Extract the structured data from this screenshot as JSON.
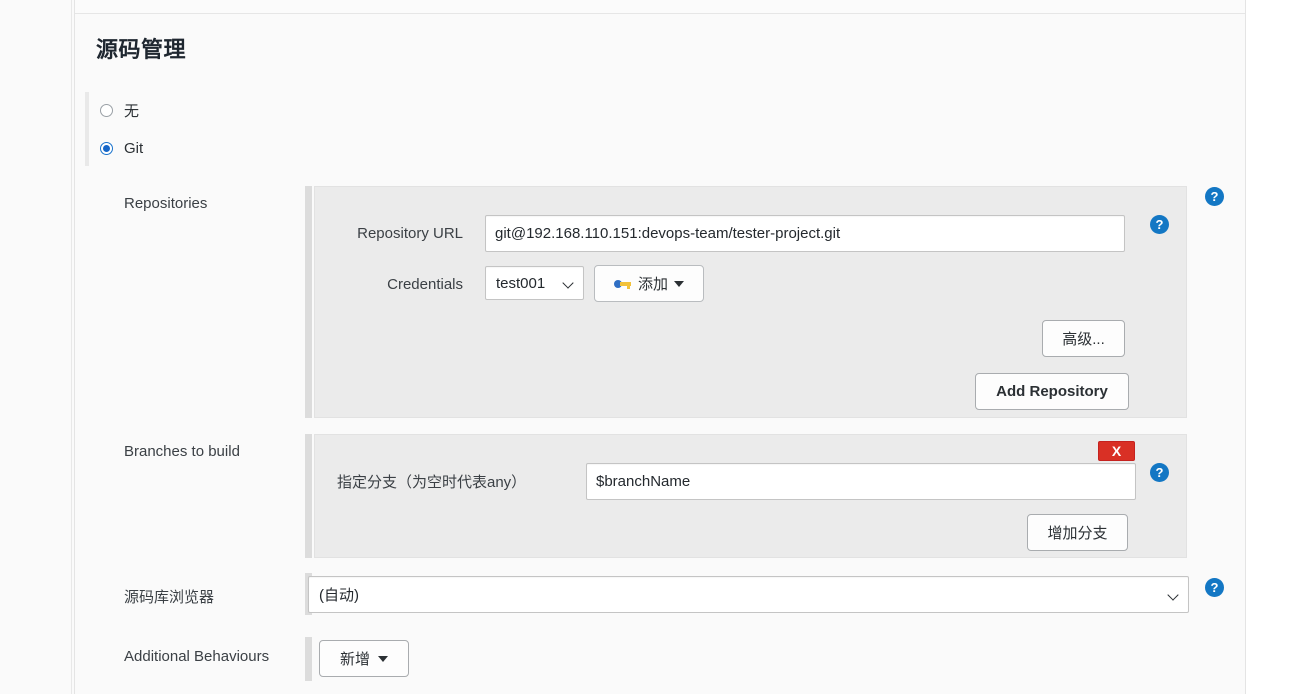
{
  "section": {
    "title": "源码管理"
  },
  "scm_choice": {
    "options": [
      {
        "label": "无",
        "checked": false
      },
      {
        "label": "Git",
        "checked": true
      }
    ]
  },
  "repositories": {
    "label": "Repositories",
    "repository_url": {
      "label": "Repository URL",
      "value": "git@192.168.110.151:devops-team/tester-project.git"
    },
    "credentials": {
      "label": "Credentials",
      "selected": "test001",
      "add_button": "添加"
    },
    "advanced_button": "高级...",
    "add_repository_button": "Add Repository"
  },
  "branches": {
    "label": "Branches to build",
    "branch_spec": {
      "label": "指定分支（为空时代表any）",
      "value": "$branchName"
    },
    "delete_button": "X",
    "add_branch_button": "增加分支"
  },
  "repo_browser": {
    "label": "源码库浏览器",
    "selected": "(自动)"
  },
  "additional_behaviours": {
    "label": "Additional Behaviours",
    "add_button": "新增"
  },
  "icons": {
    "help": "?"
  },
  "colors": {
    "accent_blue": "#1377c4",
    "radio_blue": "#1566c8",
    "delete_red": "#d93025",
    "panel_gray": "#ebebeb",
    "page_gray": "#fafafa",
    "key_gold": "#f2c23b"
  }
}
